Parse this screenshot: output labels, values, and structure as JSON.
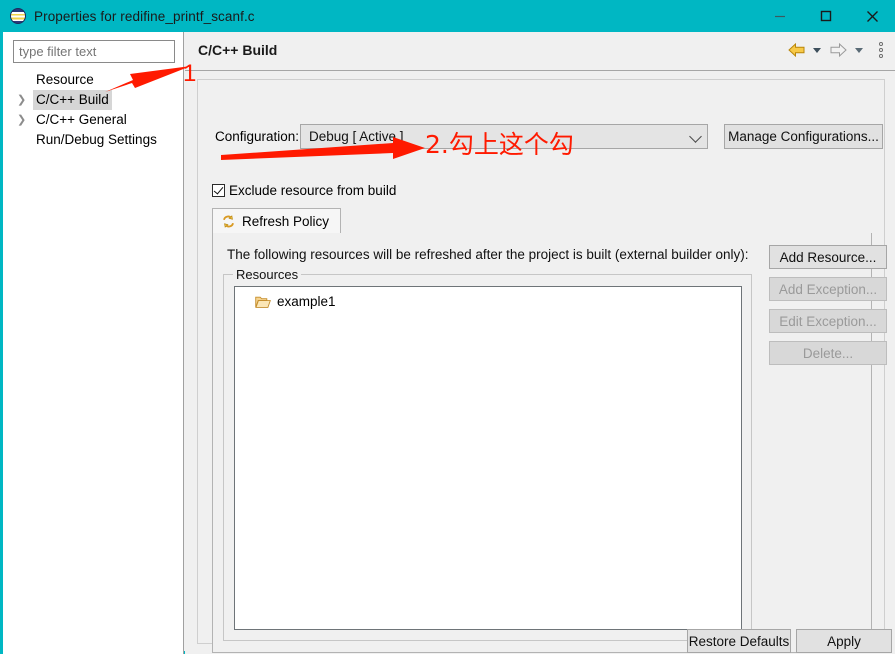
{
  "window": {
    "title": "Properties for redifine_printf_scanf.c",
    "app_icon": "eclipse-icon",
    "accent_color": "#00b7c3",
    "controls": {
      "minimize": "minimize-icon",
      "maximize": "maximize-icon",
      "close": "close-icon"
    }
  },
  "sidebar": {
    "filter": {
      "placeholder": "type filter text",
      "value": ""
    },
    "items": [
      {
        "label": "Resource",
        "expandable": false,
        "selected": false
      },
      {
        "label": "C/C++ Build",
        "expandable": true,
        "selected": true
      },
      {
        "label": "C/C++ General",
        "expandable": true,
        "selected": false
      },
      {
        "label": "Run/Debug Settings",
        "expandable": false,
        "selected": false
      }
    ]
  },
  "page": {
    "title": "C/C++ Build",
    "toolbar": {
      "back": "back-arrow-icon",
      "forward": "forward-arrow-icon",
      "menu": "view-menu-icon"
    },
    "configuration": {
      "label": "Configuration:",
      "value": "Debug  [ Active ]",
      "options": [
        "Debug  [ Active ]"
      ],
      "manage_button": "Manage Configurations..."
    },
    "exclude_checkbox": {
      "label": "Exclude resource from build",
      "checked": true
    },
    "tabs": [
      {
        "label": "Refresh Policy",
        "icon": "refresh-icon",
        "active": true
      }
    ],
    "refresh_policy": {
      "description": "The following resources will be refreshed after the project is built (external builder only):",
      "resources_group_label": "Resources",
      "resources": [
        {
          "label": "example1",
          "icon": "folder-icon"
        }
      ],
      "buttons": [
        {
          "label": "Add Resource...",
          "enabled": true
        },
        {
          "label": "Add Exception...",
          "enabled": false
        },
        {
          "label": "Edit Exception...",
          "enabled": false
        },
        {
          "label": "Delete...",
          "enabled": false
        }
      ]
    },
    "footer": {
      "restore_defaults": "Restore Defaults",
      "apply": "Apply"
    }
  },
  "annotations": {
    "color": "#ff1a00",
    "step1_number": "1",
    "step2_text": "2.勾上这个勾"
  }
}
